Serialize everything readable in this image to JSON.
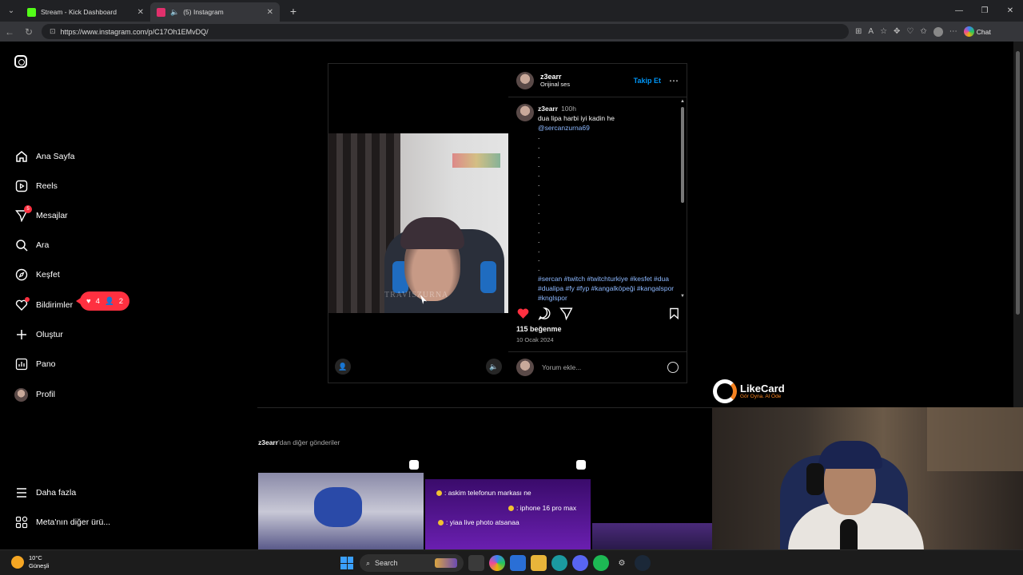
{
  "browser": {
    "tabs": [
      {
        "title": "Stream - Kick Dashboard",
        "favicon_color": "#53fc18",
        "active": false
      },
      {
        "title": "(5) Instagram",
        "favicon_color": "#e1306c",
        "active": true
      }
    ],
    "url": "https://www.instagram.com/p/C17Oh1EMvDQ/",
    "chat_label": "Chat"
  },
  "sidebar": {
    "items": [
      {
        "label": "Ana Sayfa",
        "icon": "home-icon"
      },
      {
        "label": "Reels",
        "icon": "reels-icon"
      },
      {
        "label": "Mesajlar",
        "icon": "messages-icon",
        "badge": "5"
      },
      {
        "label": "Ara",
        "icon": "search-icon"
      },
      {
        "label": "Keşfet",
        "icon": "explore-icon"
      },
      {
        "label": "Bildirimler",
        "icon": "heart-icon"
      },
      {
        "label": "Oluştur",
        "icon": "plus-icon"
      },
      {
        "label": "Pano",
        "icon": "dashboard-icon"
      },
      {
        "label": "Profil",
        "icon": "avatar"
      }
    ],
    "notifications_pill": {
      "likes": "4",
      "follows": "2"
    },
    "more_label": "Daha fazla",
    "meta_label": "Meta'nın diğer ürü..."
  },
  "post": {
    "author": "z3earr",
    "audio": "Orijinal ses",
    "follow_label": "Takip Et",
    "caption_author": "z3earr",
    "caption_time": "100h",
    "caption_text": "dua lipa harbi iyi kadin he",
    "mention": "@sercanzurna69",
    "hashtags": "#sercan #twitch #twitchturkiye #kesfet #dua #dualipa #fy #fyp #kangalköpeği #kangalspor #knglspor",
    "watermark": "TRAVISZURNA",
    "likes": "115 beğenme",
    "date": "10 Ocak 2024",
    "comment_placeholder": "Yorum ekle...",
    "like_color": "#ff3040"
  },
  "more_posts": {
    "title_user": "z3earr",
    "title_rest": "'dan diğer gönderiler",
    "chat_lines": [
      ": askim telefonun markası ne",
      ": iphone 16 pro max",
      ": yiaa live photo atsanaa"
    ]
  },
  "overlay": {
    "brand": "LikeCard",
    "tagline": "Gör Oyna. Al Öde"
  },
  "taskbar": {
    "temperature": "10°C",
    "weather": "Güneşli",
    "search_label": "Search"
  }
}
